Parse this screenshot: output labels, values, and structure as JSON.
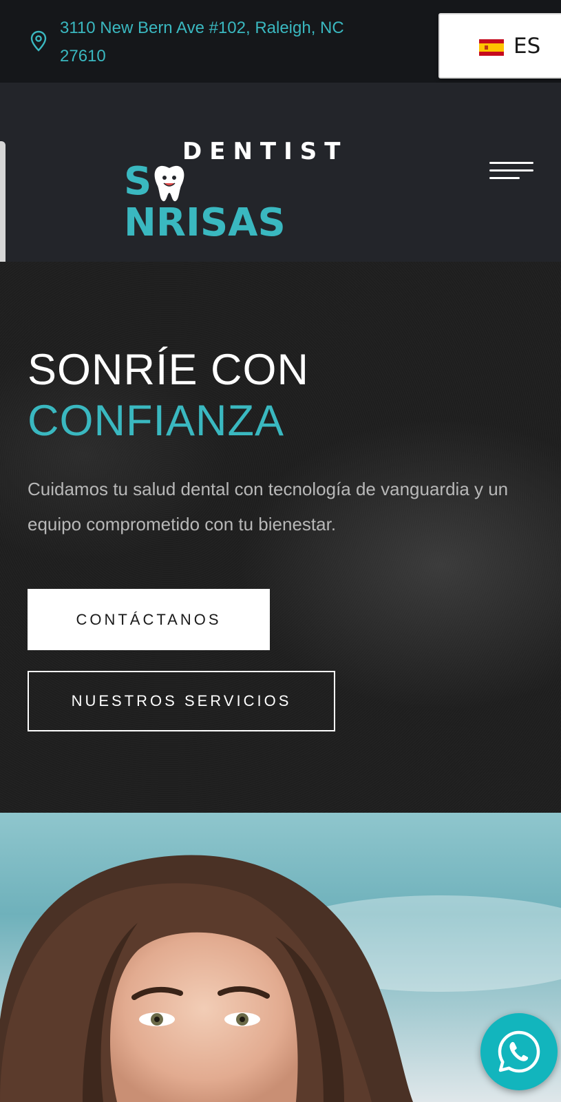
{
  "topbar": {
    "address": "3110 New Bern Ave #102, Raleigh, NC 27610",
    "language": {
      "code": "ES",
      "flag": "spain-flag-icon"
    }
  },
  "header": {
    "logo": {
      "line1": "DENTIST",
      "line2_part1": "S",
      "line2_part2": "NRISAS"
    },
    "menu_icon": "hamburger-menu-icon"
  },
  "hero": {
    "title_line1": "SONRÍE CON",
    "title_line2": "CONFIANZA",
    "text": "Cuidamos tu salud dental con tecnología de vanguardia y un equipo comprometido con tu bienestar.",
    "primary_button": "CONTÁCTANOS",
    "secondary_button": "NUESTROS SERVICIOS"
  },
  "floating": {
    "whatsapp_icon": "whatsapp-icon"
  },
  "colors": {
    "accent": "#3ab8c0",
    "topbar_bg": "#15171a",
    "header_bg": "#23252a",
    "whatsapp": "#12b5bd"
  }
}
